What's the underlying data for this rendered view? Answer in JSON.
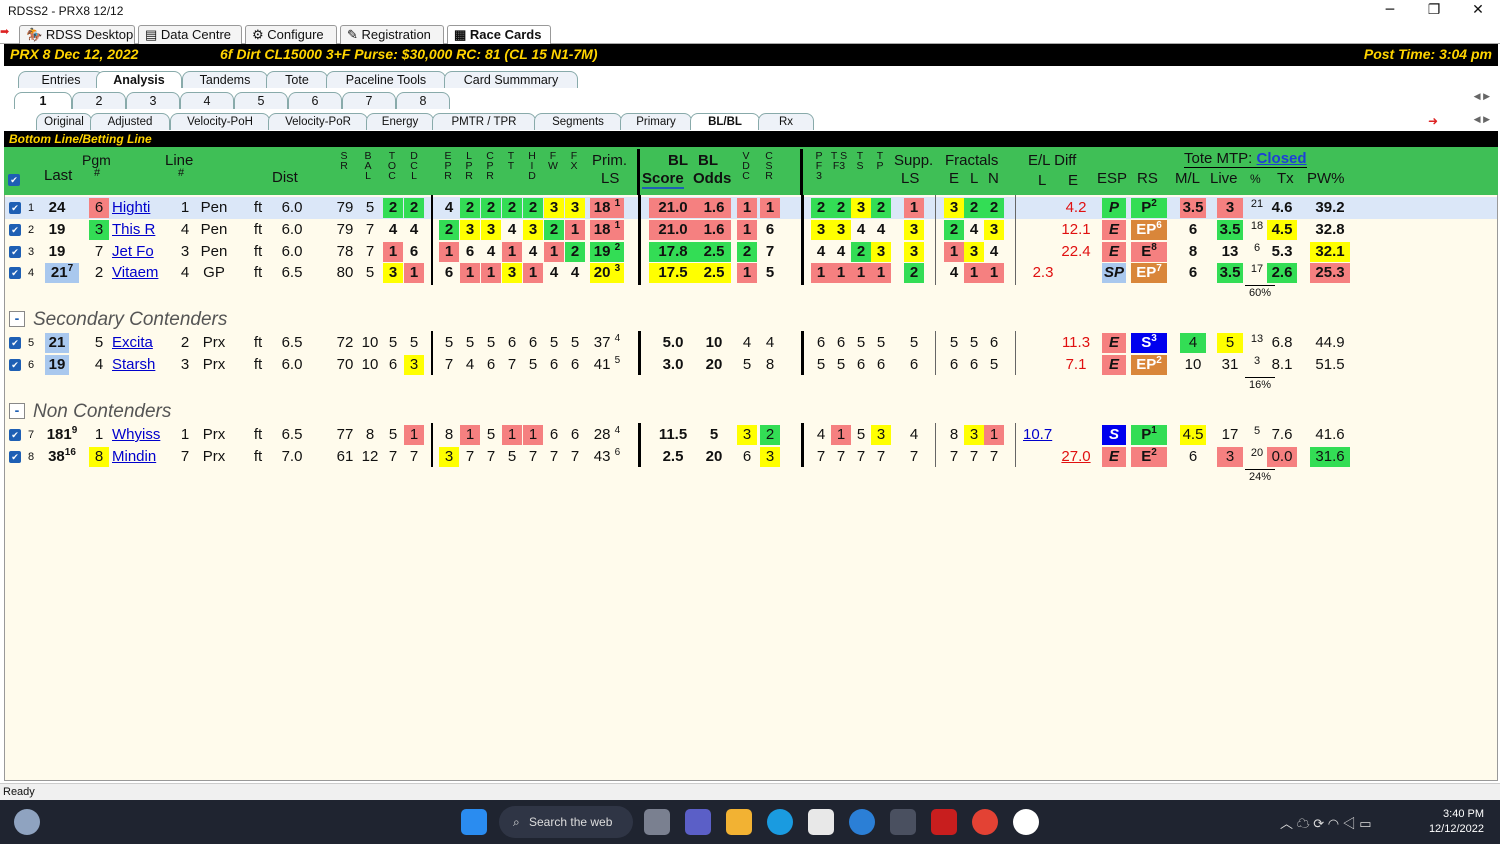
{
  "window": {
    "title": "RDSS2 - PRX8  12/12",
    "min": "─",
    "max": "❐",
    "close": "✕"
  },
  "app_tabs": [
    "RDSS Desktop",
    "Data Centre",
    "Configure",
    "Registration",
    "Race Cards"
  ],
  "race": {
    "label": "PRX  8   Dec 12, 2022",
    "conditions": "6f  Dirt   CL15000  3+F   Purse: $30,000   RC: 81  (CL 15 N1-7M)",
    "post_time": "Post Time: 3:04 pm"
  },
  "main_tabs": [
    "Entries",
    "Analysis",
    "Tandems",
    "Tote",
    "Paceline Tools",
    "Card Summmary"
  ],
  "num_tabs": [
    "1",
    "2",
    "3",
    "4",
    "5",
    "6",
    "7",
    "8"
  ],
  "sub_tabs": [
    "Original",
    "Adjusted",
    "Velocity-PoH",
    "Velocity-PoR",
    "Energy",
    "PMTR / TPR",
    "Segments",
    "Primary",
    "BL/BL",
    "Rx"
  ],
  "section_title": "Bottom Line/Betting Line",
  "headers": {
    "pgm": "Pgm",
    "pgm_hash": "#",
    "last": "Last",
    "line": "Line",
    "line_hash": "#",
    "dist": "Dist",
    "sr": "S R",
    "bal": "B A L",
    "toc": "T O C",
    "dcl": "D C L",
    "epr": "E P R",
    "lpr": "L P R",
    "cpr": "C P R",
    "tt": "T T",
    "hid": "H I D",
    "fw": "F W",
    "fx": "F X",
    "prim": "Prim.",
    "ls": "LS",
    "bl1": "BL",
    "bl2": "BL",
    "score": "Score",
    "odds": "Odds",
    "vdc": "V D C",
    "csr": "C S R",
    "pf3": "P F 3",
    "tsf3": "T S F3",
    "ts": "T S",
    "tp": "T P",
    "supp": "Supp.",
    "supp_ls": "LS",
    "fractals": "Fractals",
    "e": "E",
    "l": "L",
    "n": "N",
    "el_diff": "E/L Diff",
    "el_l": "L",
    "el_e": "E",
    "esp": "ESP",
    "rs": "RS",
    "tote_mtp": "Tote MTP:",
    "closed": "Closed",
    "ml": "M/L",
    "live": "Live",
    "pctsym": "%",
    "tx": "Tx",
    "pw": "PW%"
  },
  "groups": {
    "secondary": "Secondary Contenders",
    "non": "Non Contenders",
    "minus": "-"
  },
  "rows": [
    {
      "n": "1",
      "last": "24",
      "pgm": "6",
      "name": "Highti",
      "line": "1",
      "trk": "Pen",
      "surf": "ft",
      "dist": "6.0",
      "sr": "79",
      "bal": "5",
      "toc": "2",
      "dcl": "2",
      "epr": "4",
      "lpr": "2",
      "cpr": "2",
      "tt": "2",
      "hid": "2",
      "fw": "3",
      "fx": "3",
      "prim": "18",
      "primr": "1",
      "score": "21.0",
      "odds": "1.6",
      "vdc": "1",
      "csr": "1",
      "pf3": "2",
      "tsf3": "2",
      "ts": "3",
      "tp": "2",
      "supp": "1",
      "fe": "3",
      "fl": "2",
      "fn": "2",
      "ell": "",
      "ele": "4.2",
      "esp": "P",
      "rs": "P",
      "rss": "2",
      "ml": "3.5",
      "live": "3",
      "pct": "21",
      "tx": "4.6",
      "pw": "39.2"
    },
    {
      "n": "2",
      "last": "19",
      "pgm": "3",
      "name": "This R",
      "line": "4",
      "trk": "Pen",
      "surf": "ft",
      "dist": "6.0",
      "sr": "79",
      "bal": "7",
      "toc": "4",
      "dcl": "4",
      "epr": "2",
      "lpr": "3",
      "cpr": "3",
      "tt": "4",
      "hid": "3",
      "fw": "2",
      "fx": "1",
      "prim": "18",
      "primr": "1",
      "score": "21.0",
      "odds": "1.6",
      "vdc": "1",
      "csr": "6",
      "pf3": "3",
      "tsf3": "3",
      "ts": "4",
      "tp": "4",
      "supp": "3",
      "fe": "2",
      "fl": "4",
      "fn": "3",
      "ell": "",
      "ele": "12.1",
      "esp": "E",
      "rs": "EP",
      "rss": "6",
      "ml": "6",
      "live": "3.5",
      "pct": "18",
      "tx": "4.5",
      "pw": "32.8"
    },
    {
      "n": "3",
      "last": "19",
      "pgm": "7",
      "name": "Jet Fo",
      "line": "3",
      "trk": "Pen",
      "surf": "ft",
      "dist": "6.0",
      "sr": "78",
      "bal": "7",
      "toc": "1",
      "dcl": "6",
      "epr": "1",
      "lpr": "6",
      "cpr": "4",
      "tt": "1",
      "hid": "4",
      "fw": "1",
      "fx": "2",
      "prim": "19",
      "primr": "2",
      "score": "17.8",
      "odds": "2.5",
      "vdc": "2",
      "csr": "7",
      "pf3": "4",
      "tsf3": "4",
      "ts": "2",
      "tp": "3",
      "supp": "3",
      "fe": "1",
      "fl": "3",
      "fn": "4",
      "ell": "",
      "ele": "22.4",
      "esp": "E",
      "rs": "E",
      "rss": "8",
      "ml": "8",
      "live": "13",
      "pct": "6",
      "tx": "5.3",
      "pw": "32.1"
    },
    {
      "n": "4",
      "last": "21",
      "lastsup": "7",
      "pgm": "2",
      "name": "Vitaem",
      "line": "4",
      "trk": "GP",
      "surf": "ft",
      "dist": "6.5",
      "sr": "80",
      "bal": "5",
      "toc": "3",
      "dcl": "1",
      "epr": "6",
      "lpr": "1",
      "cpr": "1",
      "tt": "3",
      "hid": "1",
      "fw": "4",
      "fx": "4",
      "prim": "20",
      "primr": "3",
      "score": "17.5",
      "odds": "2.5",
      "vdc": "1",
      "csr": "5",
      "pf3": "1",
      "tsf3": "1",
      "ts": "1",
      "tp": "1",
      "supp": "2",
      "fe": "4",
      "fl": "1",
      "fn": "1",
      "ell": "2.3",
      "ele": "",
      "esp": "SP",
      "rs": "EP",
      "rss": "7",
      "ml": "6",
      "live": "3.5",
      "pct": "17",
      "tx": "2.6",
      "pw": "25.3",
      "pcttotal": "60%"
    },
    {
      "n": "5",
      "last": "21",
      "pgm": "5",
      "name": "Excita",
      "line": "2",
      "trk": "Prx",
      "surf": "ft",
      "dist": "6.5",
      "sr": "72",
      "bal": "10",
      "toc": "5",
      "dcl": "5",
      "epr": "5",
      "lpr": "5",
      "cpr": "5",
      "tt": "6",
      "hid": "6",
      "fw": "5",
      "fx": "5",
      "prim": "37",
      "primr": "4",
      "score": "5.0",
      "odds": "10",
      "vdc": "4",
      "csr": "4",
      "pf3": "6",
      "tsf3": "6",
      "ts": "5",
      "tp": "5",
      "supp": "5",
      "fe": "5",
      "fl": "5",
      "fn": "6",
      "ell": "",
      "ele": "11.3",
      "esp": "E",
      "rs": "S",
      "rss": "3",
      "ml": "4",
      "live": "5",
      "pct": "13",
      "tx": "6.8",
      "pw": "44.9"
    },
    {
      "n": "6",
      "last": "19",
      "pgm": "4",
      "name": "Starsh",
      "line": "3",
      "trk": "Prx",
      "surf": "ft",
      "dist": "6.0",
      "sr": "70",
      "bal": "10",
      "toc": "6",
      "dcl": "3",
      "epr": "7",
      "lpr": "4",
      "cpr": "6",
      "tt": "7",
      "hid": "5",
      "fw": "6",
      "fx": "6",
      "prim": "41",
      "primr": "5",
      "score": "3.0",
      "odds": "20",
      "vdc": "5",
      "csr": "8",
      "pf3": "5",
      "tsf3": "5",
      "ts": "6",
      "tp": "6",
      "supp": "6",
      "fe": "6",
      "fl": "6",
      "fn": "5",
      "ell": "",
      "ele": "7.1",
      "esp": "E",
      "rs": "EP",
      "rss": "2",
      "ml": "10",
      "live": "31",
      "pct": "3",
      "tx": "8.1",
      "pw": "51.5",
      "pcttotal": "16%"
    },
    {
      "n": "7",
      "last": "181",
      "lastsup": "9",
      "pgm": "1",
      "name": "Whyiss",
      "line": "1",
      "trk": "Prx",
      "surf": "ft",
      "dist": "6.5",
      "sr": "77",
      "bal": "8",
      "toc": "5",
      "dcl": "1",
      "epr": "8",
      "lpr": "1",
      "cpr": "5",
      "tt": "1",
      "hid": "1",
      "fw": "6",
      "fx": "6",
      "prim": "28",
      "primr": "4",
      "score": "11.5",
      "odds": "5",
      "vdc": "3",
      "csr": "2",
      "pf3": "4",
      "tsf3": "1",
      "ts": "5",
      "tp": "3",
      "supp": "4",
      "fe": "8",
      "fl": "3",
      "fn": "1",
      "ell": "10.7",
      "ele": "",
      "esp": "S",
      "rs": "P",
      "rss": "1",
      "ml": "4.5",
      "live": "17",
      "pct": "5",
      "tx": "7.6",
      "pw": "41.6"
    },
    {
      "n": "8",
      "last": "38",
      "lastsup": "16",
      "pgm": "8",
      "name": "Mindin",
      "line": "7",
      "trk": "Prx",
      "surf": "ft",
      "dist": "7.0",
      "sr": "61",
      "bal": "12",
      "toc": "7",
      "dcl": "7",
      "epr": "3",
      "lpr": "7",
      "cpr": "7",
      "tt": "5",
      "hid": "7",
      "fw": "7",
      "fx": "7",
      "prim": "43",
      "primr": "6",
      "score": "2.5",
      "odds": "20",
      "vdc": "6",
      "csr": "3",
      "pf3": "7",
      "tsf3": "7",
      "ts": "7",
      "tp": "7",
      "supp": "7",
      "fe": "7",
      "fl": "7",
      "fn": "7",
      "ell": "",
      "ele": "27.0",
      "esp": "E",
      "rs": "E",
      "rss": "2",
      "ml": "6",
      "live": "3",
      "pct": "20",
      "tx": "0.0",
      "pw": "31.6",
      "pcttotal": "24%"
    }
  ],
  "status": "Ready",
  "taskbar": {
    "search": "Search the web",
    "time": "3:40 PM",
    "date": "12/12/2022"
  }
}
